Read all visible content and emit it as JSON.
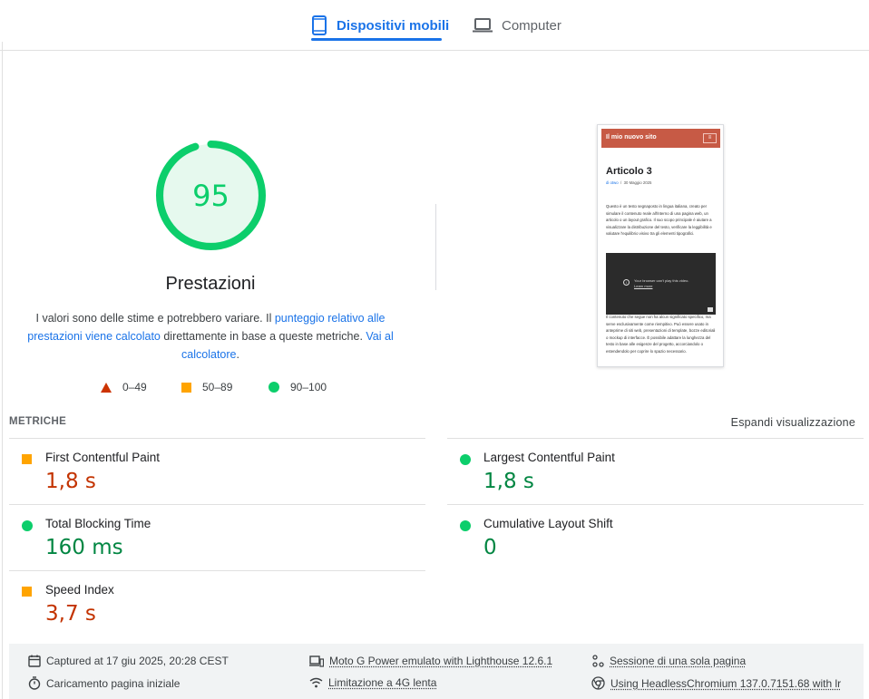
{
  "tabs": [
    {
      "label": "Dispositivi mobili",
      "icon": "smartphone-icon",
      "active": true
    },
    {
      "label": "Computer",
      "icon": "laptop-icon",
      "active": false
    }
  ],
  "score": {
    "value": 95,
    "fraction": 0.95,
    "category": "Prestazioni",
    "color": "#0cce6b"
  },
  "description": {
    "part1": "I valori sono delle stime e potrebbero variare. Il ",
    "link1": "punteggio relativo alle prestazioni viene calcolato",
    "part2": " direttamente in base a queste metriche. ",
    "link2": "Vai al calcolatore",
    "part3": "."
  },
  "legend": [
    {
      "range": "0–49",
      "icon": "red-triangle-icon",
      "color": "#cc3300"
    },
    {
      "range": "50–89",
      "icon": "orange-square-icon",
      "color": "#ffa400"
    },
    {
      "range": "90–100",
      "icon": "green-circle-icon",
      "color": "#0cce6b"
    }
  ],
  "preview": {
    "site_title": "Il mio nuovo sito",
    "menu_glyph": "≡",
    "post_title": "Articolo 3",
    "meta_author": "di otwo",
    "meta_sep": "/",
    "meta_date": "30 Maggio 2025",
    "paragraph1": "Questo è un testo segnaposto in lingua italiana, creato per simulare il contenuto reale all'interno di una pagina web, un articolo o un layout grafico. Il suo scopo principale è aiutare a visualizzare la distribuzione del testo, verificare la leggibilità e valutare l'equilibrio visivo tra gli elementi tipografici.",
    "video_message": "Your browser can't play this video.",
    "video_link": "Learn more",
    "paragraph2": "Il contenuto che segue non ha alcun significato specifico, ma serve esclusivamente come riempitivo. Può essere usato in anteprime di siti web, presentazioni di template, bozze editoriali o mockup di interfacce. È possibile adattare la lunghezza del testo in base alle esigenze del progetto, accorciandolo o estendendolo per coprire lo spazio necessario."
  },
  "metrics": {
    "title": "METRICHE",
    "expand_label": "Espandi visualizzazione",
    "items": [
      {
        "label": "First Contentful Paint",
        "value": "1,8 s",
        "rating": "average"
      },
      {
        "label": "Largest Contentful Paint",
        "value": "1,8 s",
        "rating": "good"
      },
      {
        "label": "Total Blocking Time",
        "value": "160 ms",
        "rating": "good"
      },
      {
        "label": "Cumulative Layout Shift",
        "value": "0",
        "rating": "good"
      },
      {
        "label": "Speed Index",
        "value": "3,7 s",
        "rating": "average"
      }
    ]
  },
  "footer": {
    "captured": "Captured at 17 giu 2025, 20:28 CEST",
    "load": "Caricamento pagina iniziale",
    "device": "Moto G Power emulato with Lighthouse 12.6.1",
    "throttling": "Limitazione a 4G lenta",
    "session": "Sessione di una sola pagina",
    "browser": "Using HeadlessChromium 137.0.7151.68 with lr"
  }
}
